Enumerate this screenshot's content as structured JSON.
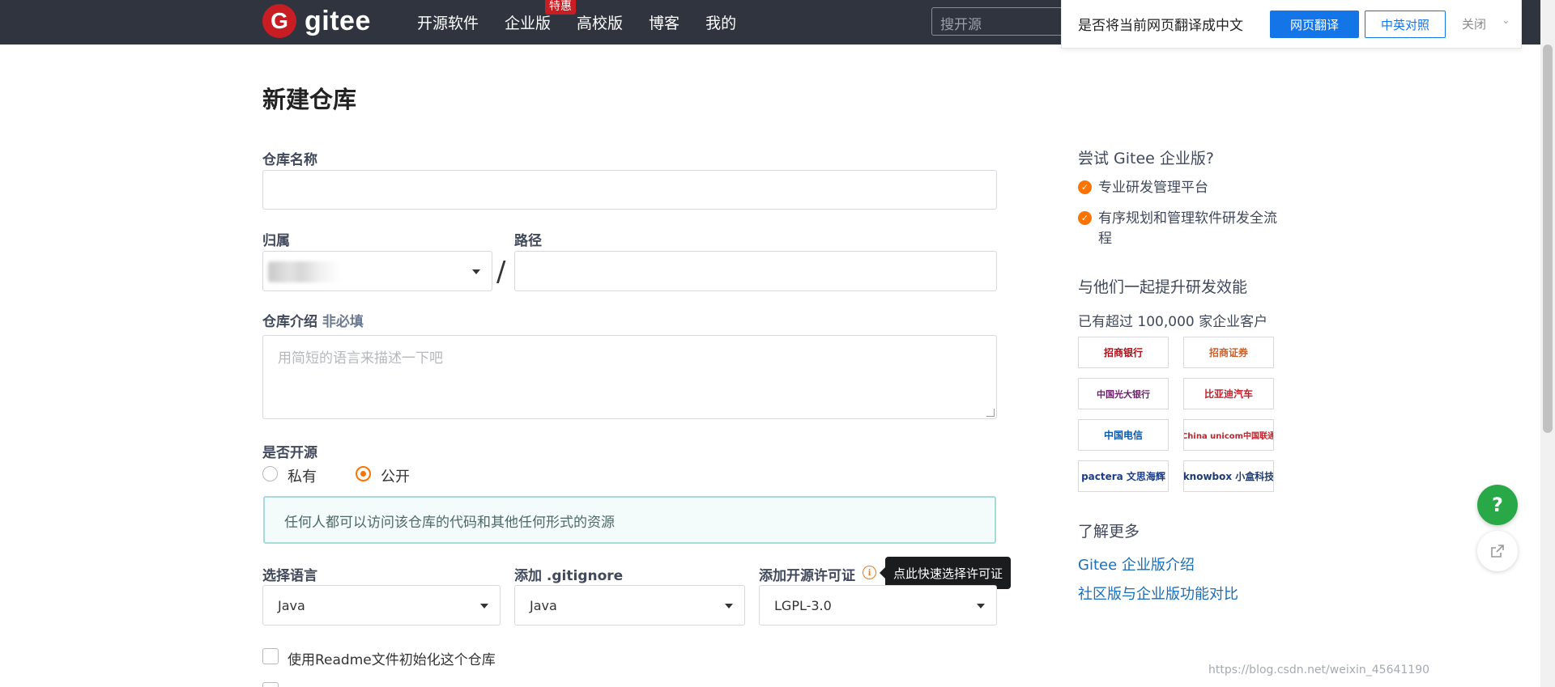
{
  "nav": {
    "logo_text": "gitee",
    "logo_letter": "G",
    "links": [
      "开源软件",
      "企业版",
      "高校版",
      "博客",
      "我的"
    ],
    "badge": "特惠",
    "search_placeholder": "搜开源"
  },
  "translate_bar": {
    "prompt": "是否将当前网页翻译成中文",
    "translate_btn": "网页翻译",
    "bilingual_btn": "中英对照",
    "close": "关闭"
  },
  "form": {
    "title": "新建仓库",
    "repo_name_label": "仓库名称",
    "owner_label": "归属",
    "path_label": "路径",
    "separator": "/",
    "desc_label": "仓库介绍",
    "desc_optional": "非必填",
    "desc_placeholder": "用简短的语言来描述一下吧",
    "visibility_label": "是否开源",
    "private_label": "私有",
    "public_label": "公开",
    "visibility_selected": "公开",
    "public_info": "任何人都可以访问该仓库的代码和其他任何形式的资源",
    "language_label": "选择语言",
    "language_value": "Java",
    "gitignore_label": "添加 .gitignore",
    "gitignore_value": "Java",
    "license_label": "添加开源许可证",
    "license_value": "LGPL-3.0",
    "license_tooltip": "点此快速选择许可证",
    "readme_label": "使用Readme文件初始化这个仓库"
  },
  "sidebar": {
    "try_heading": "尝试 Gitee 企业版?",
    "features": [
      "专业研发管理平台",
      "有序规划和管理软件研发全流程"
    ],
    "together_heading": "与他们一起提升研发效能",
    "customers": "已有超过 100,000 家企业客户",
    "logos": [
      "招商银行",
      "招商证券",
      "中国光大银行",
      "比亚迪汽车",
      "中国电信",
      "China unicom中国联通",
      "pactera 文思海辉",
      "knowbox 小盒科技"
    ],
    "learn_heading": "了解更多",
    "links": [
      "Gitee 企业版介绍",
      "社区版与企业版功能对比"
    ]
  },
  "float_buttons": {
    "help": "?"
  },
  "watermark": "https://blog.csdn.net/weixin_45641190",
  "colors": {
    "nav_bg": "#2f343f",
    "brand_red": "#c71d23",
    "accent_orange": "#fe7300",
    "link_blue": "#1a6fb8",
    "help_green": "#29a847"
  }
}
